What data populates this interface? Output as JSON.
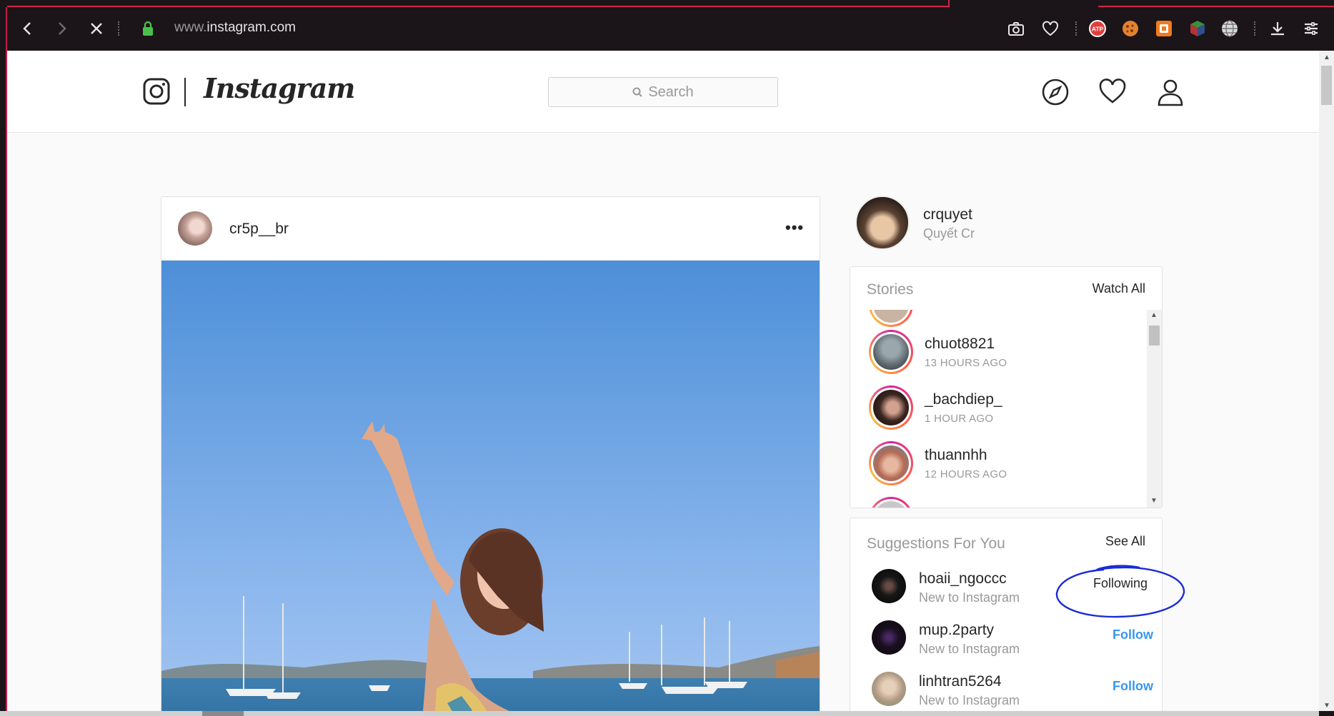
{
  "browser": {
    "url_prefix": "www.",
    "url_domain": "instagram.com",
    "icons": [
      "back-icon",
      "forward-icon",
      "stop-icon",
      "lock-icon",
      "camera-icon",
      "heart-icon",
      "atp-extension-icon",
      "cookie-extension-icon",
      "orange-extension-icon",
      "cube-extension-icon",
      "globe-icon",
      "download-icon",
      "menu-icon"
    ],
    "atp_label": "ATP"
  },
  "header": {
    "logo_text": "Instagram",
    "search_placeholder": "Search"
  },
  "post": {
    "username": "cr5p__br",
    "more_label": "•••"
  },
  "profile": {
    "username": "crquyet",
    "full_name": "Quyết Cr"
  },
  "stories": {
    "title": "Stories",
    "watch_all": "Watch All",
    "items": [
      {
        "name": "chuot8821",
        "time": "13 HOURS AGO"
      },
      {
        "name": "_bachdiep_",
        "time": "1 HOUR AGO"
      },
      {
        "name": "thuannhh",
        "time": "12 HOURS AGO"
      }
    ]
  },
  "suggestions": {
    "title": "Suggestions For You",
    "see_all": "See All",
    "items": [
      {
        "name": "hoaii_ngoccc",
        "sub": "New to Instagram",
        "action": "Following"
      },
      {
        "name": "mup.2party",
        "sub": "New to Instagram",
        "action": "Follow"
      },
      {
        "name": "linhtran5264",
        "sub": "New to Instagram",
        "action": "Follow"
      }
    ]
  },
  "colors": {
    "accent_follow": "#3897f0",
    "annotation_circle": "#1a2bd6",
    "tab_accent": "#d0264a",
    "story_ring": "#d6249f"
  }
}
